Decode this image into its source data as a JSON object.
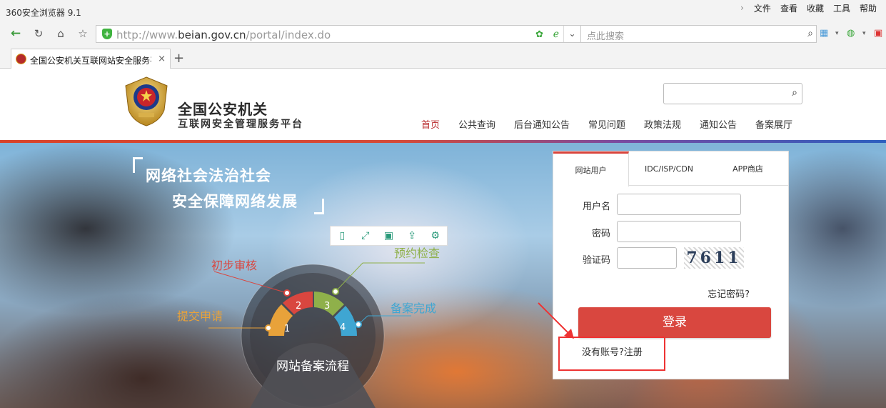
{
  "browser": {
    "title": "360安全浏览器 9.1",
    "menu": [
      "文件",
      "查看",
      "收藏",
      "工具",
      "帮助"
    ],
    "url_prefix": "http://www.",
    "url_domain": "beian.gov.cn",
    "url_path": "/portal/index.do",
    "search_placeholder": "点此搜索",
    "tab_title": "全国公安机关互联网站安全服务平",
    "tab_close": "×",
    "new_tab": "+"
  },
  "site": {
    "brand_line1": "全国公安机关",
    "brand_line2": "互联网安全管理服务平台",
    "nav": [
      "首页",
      "公共查询",
      "后台通知公告",
      "常见问题",
      "政策法规",
      "通知公告",
      "备案展厅"
    ],
    "active_nav": "首页"
  },
  "banner": {
    "slogan1": "网络社会法治社会",
    "slogan2": "安全保障网络发展",
    "process_title": "网站备案流程",
    "steps": [
      {
        "num": "1",
        "label": "提交申请",
        "color": "#e8a23a"
      },
      {
        "num": "2",
        "label": "初步审核",
        "color": "#d9463f"
      },
      {
        "num": "3",
        "label": "预约检查",
        "color": "#8fb04a"
      },
      {
        "num": "4",
        "label": "备案完成",
        "color": "#3fa6d2"
      }
    ]
  },
  "login": {
    "tabs": [
      "网站用户",
      "IDC/ISP/CDN",
      "APP商店"
    ],
    "username_label": "用户名",
    "password_label": "密码",
    "captcha_label": "验证码",
    "captcha_text": "7611",
    "forgot": "忘记密码?",
    "login_button": "登录",
    "register_text": "没有账号?注册"
  }
}
